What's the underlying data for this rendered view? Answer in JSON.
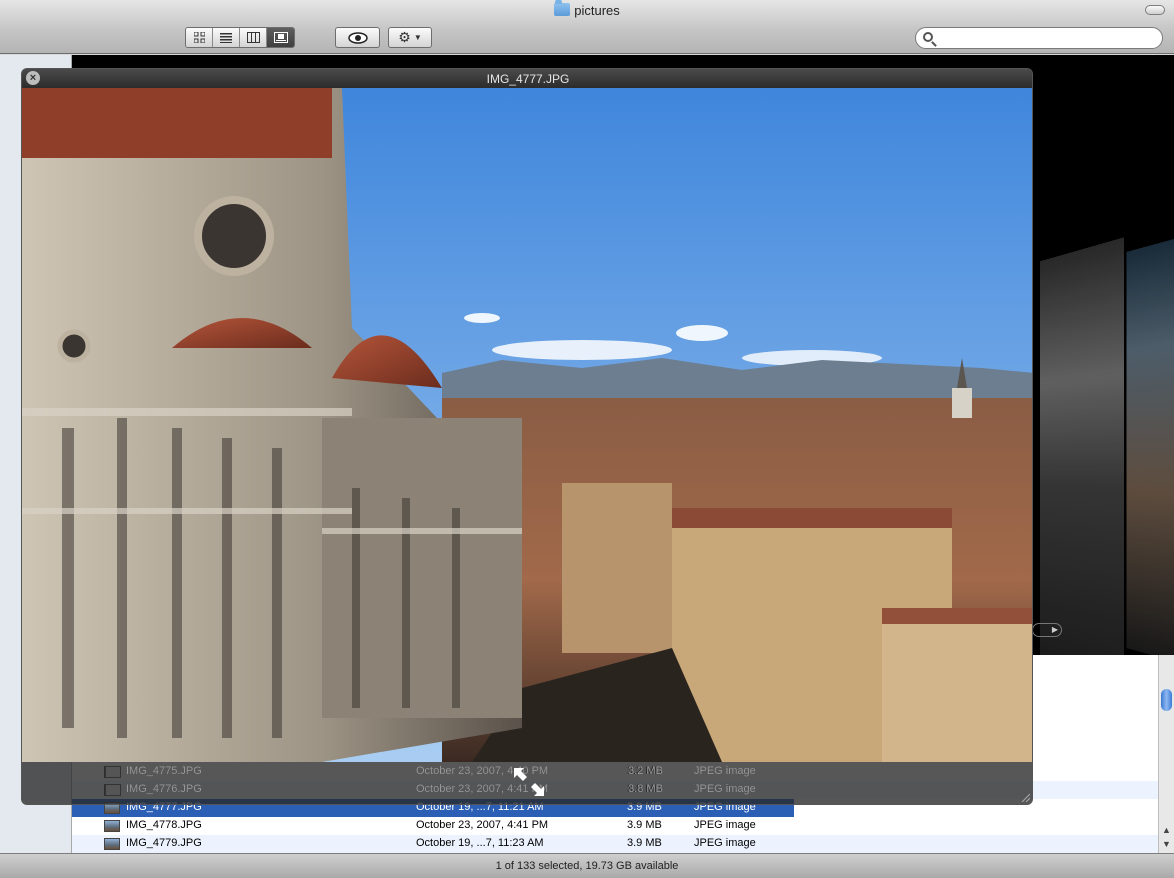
{
  "window": {
    "title": "pictures"
  },
  "toolbar": {
    "views": [
      "icon-view",
      "list-view",
      "column-view",
      "coverflow-view"
    ],
    "active_view": "coverflow-view",
    "search_placeholder": ""
  },
  "quicklook": {
    "title": "IMG_4777.JPG",
    "close_label": "×"
  },
  "files": {
    "rows": [
      {
        "name": "IMG_4775.JPG",
        "date": "October 23, 2007, 4:40 PM",
        "size": "3.2 MB",
        "kind": "JPEG image"
      },
      {
        "name": "IMG_4776.JPG",
        "date": "October 23, 2007, 4:41 PM",
        "size": "3.8 MB",
        "kind": "JPEG image"
      },
      {
        "name": "IMG_4777.JPG",
        "date": "October 19, ...7, 11:21 AM",
        "size": "3.9 MB",
        "kind": "JPEG image"
      },
      {
        "name": "IMG_4778.JPG",
        "date": "October 23, 2007, 4:41 PM",
        "size": "3.9 MB",
        "kind": "JPEG image"
      },
      {
        "name": "IMG_4779.JPG",
        "date": "October 19, ...7, 11:23 AM",
        "size": "3.9 MB",
        "kind": "JPEG image"
      }
    ],
    "selected_index": 2
  },
  "status": {
    "text": "1 of 133 selected, 19.73 GB available"
  },
  "colors": {
    "selection": "#2b5fb5",
    "row_alt": "#edf3fe",
    "sky": "#6aa8e8"
  }
}
